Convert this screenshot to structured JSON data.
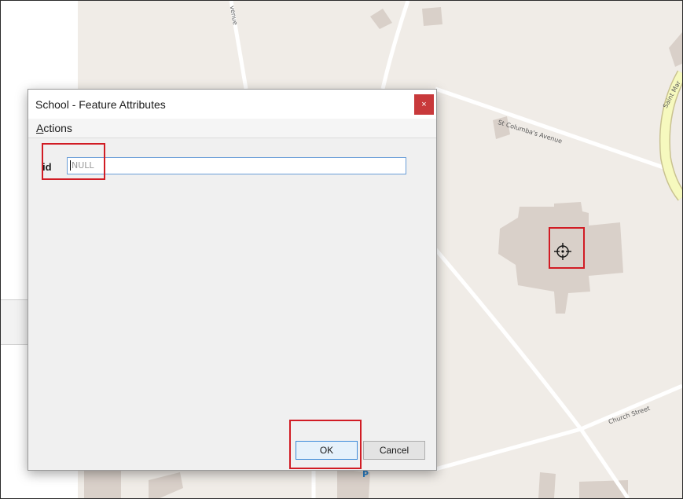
{
  "map": {
    "labels": {
      "avenue_fragment": "venue",
      "st_columbas_avenue": "St Columba's Avenue",
      "saint_mary_fragment": "Saint Mar",
      "church_street": "Church Street",
      "parking": "P"
    },
    "colors": {
      "background": "#f0ece7",
      "building": "#d9d0c9",
      "road": "#ffffff",
      "major_road": "#f6f9be",
      "major_road_casing": "#c9c290",
      "annotation_box": "#d11c24"
    },
    "crosshair_icon": "crosshair-target-icon"
  },
  "dialog": {
    "title": "School - Feature Attributes",
    "close_icon": "close-icon",
    "close_glyph": "×",
    "menu": {
      "actions_mnemonic": "A",
      "actions_rest": "ctions"
    },
    "fields": [
      {
        "label": "id",
        "value": "",
        "placeholder": "NULL"
      }
    ],
    "buttons": {
      "ok": "OK",
      "cancel": "Cancel"
    }
  }
}
